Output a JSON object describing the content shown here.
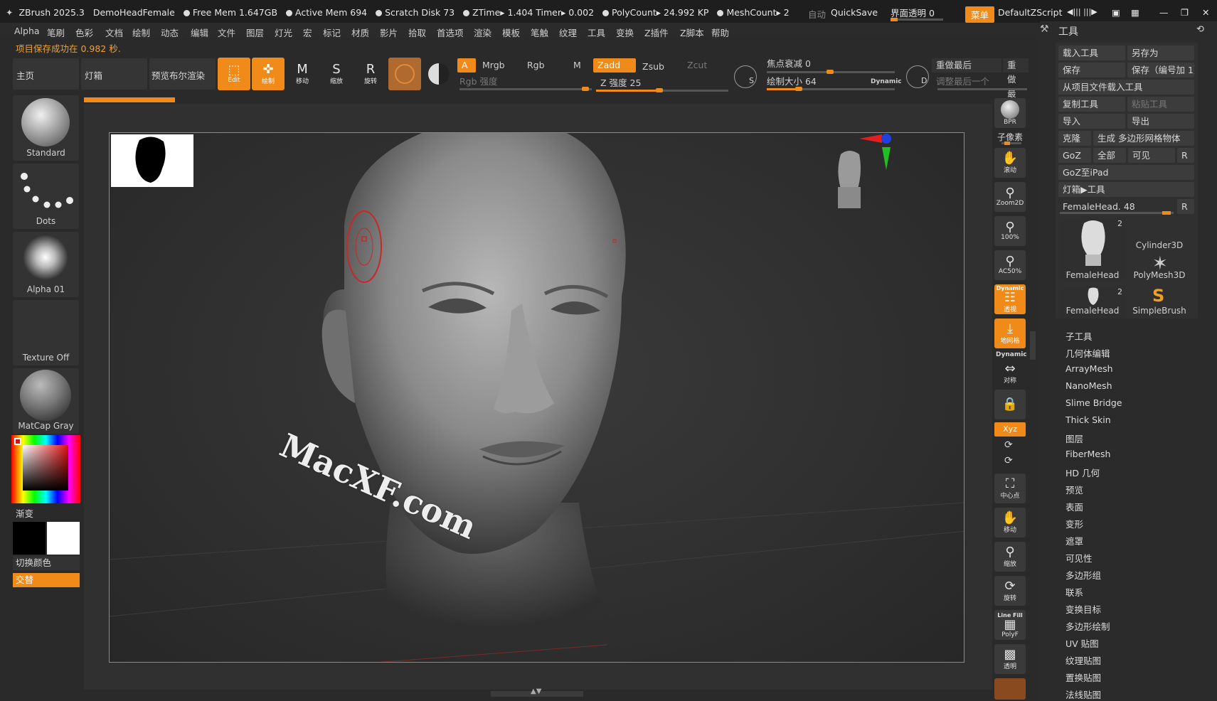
{
  "titlebar": {
    "app": "ZBrush 2025.3",
    "doc": "DemoHeadFemale",
    "free_mem": "Free Mem 1.647GB",
    "active_mem": "Active Mem 694",
    "scratch": "Scratch Disk 73",
    "ztime": "ZTime▸ 1.404 Timer▸ 0.002",
    "polycount": "PolyCount▸ 24.992 KP",
    "meshcount": "MeshCount▸ 2",
    "auto": "自动",
    "quicksave": "QuickSave",
    "ui_opacity": "界面透明 0",
    "menu_btn": "菜单",
    "default_script": "DefaultZScript"
  },
  "menubar": [
    "Alpha",
    "笔刷",
    "色彩",
    "文档",
    "绘制",
    "动态",
    "编辑",
    "文件",
    "图层",
    "灯光",
    "宏",
    "标记",
    "材质",
    "影片",
    "拾取",
    "首选项",
    "渲染",
    "模板",
    "笔触",
    "纹理",
    "工具",
    "变换",
    "Z插件",
    "Z脚本",
    "帮助"
  ],
  "status": "项目保存成功在 0.982 秒.",
  "toolbar": {
    "home": "主页",
    "lightbox": "灯箱",
    "bool_render": "预览布尔渲染",
    "edit": "Edit",
    "draw": "绘制",
    "move": "移动",
    "scale": "缩放",
    "rotate": "旋转",
    "a": "A",
    "mrgb": "Mrgb",
    "rgb": "Rgb",
    "m": "M",
    "zadd": "Zadd",
    "zsub": "Zsub",
    "zcut": "Zcut",
    "rgb_intensity": "Rgb 强度",
    "z_intensity": "Z 强度 25",
    "focal_shift": "焦点衰减 0",
    "draw_size": "绘制大小 64",
    "dynamic": "Dynamic",
    "redo_last": "重做最后",
    "redo_last2": "重做最",
    "adjust_last": "调整最后一个"
  },
  "left": {
    "standard": "Standard",
    "dots": "Dots",
    "alpha": "Alpha 01",
    "texture": "Texture Off",
    "matcap": "MatCap Gray",
    "gradient": "渐变",
    "switch_color": "切换颜色",
    "alternate": "交替"
  },
  "rightcol": {
    "bpr": "BPR",
    "subpixel": "子像素",
    "scroll": "滚动",
    "zoom2d": "Zoom2D",
    "z100": "100%",
    "ac50": "AC50%",
    "dynamic_label": "Dynamic",
    "persp": "透视",
    "floor": "地网格",
    "dynamic2": "Dynamic",
    "sym": "对称",
    "xyz": "Xyz",
    "center": "中心点",
    "move": "移动",
    "scale": "缩放",
    "rotate": "旋转",
    "linefill": "Line Fill",
    "polyf": "PolyF",
    "transp": "透明"
  },
  "toolpanel": {
    "title": "工具",
    "load_tool": "载入工具",
    "save_as": "另存为",
    "save": "保存",
    "save_num": "保存（编号加 1）",
    "load_from_project": "从项目文件载入工具",
    "copy_tool": "复制工具",
    "paste_tool": "粘贴工具",
    "import": "导入",
    "export": "导出",
    "clone": "克隆",
    "make_polymesh": "生成 多边形网格物体",
    "goz": "GoZ",
    "all": "全部",
    "visible": "可见",
    "r": "R",
    "goz_ipad": "GoZ至iPad",
    "lightbox_tool": "灯箱▶工具",
    "current_tool": "FemaleHead. 48",
    "thumbs": [
      {
        "label": "FemaleHead",
        "count": "2"
      },
      {
        "label": "Cylinder3D",
        "count": ""
      },
      {
        "label": "PolyMesh3D",
        "count": ""
      },
      {
        "label": "FemaleHead",
        "count": "2"
      },
      {
        "label": "SimpleBrush",
        "count": ""
      }
    ],
    "items": [
      "子工具",
      "几何体编辑",
      "ArrayMesh",
      "NanoMesh",
      "Slime Bridge",
      "Thick Skin",
      "图层",
      "FiberMesh",
      "HD 几何",
      "预览",
      "表面",
      "变形",
      "遮罩",
      "可见性",
      "多边形组",
      "联系",
      "变换目标",
      "多边形绘制",
      "UV 贴图",
      "纹理贴图",
      "置换贴图",
      "法线贴图"
    ]
  },
  "watermark": "MacXF.com",
  "colors": {
    "accent": "#f08a18",
    "bg": "#2a2a2a"
  }
}
